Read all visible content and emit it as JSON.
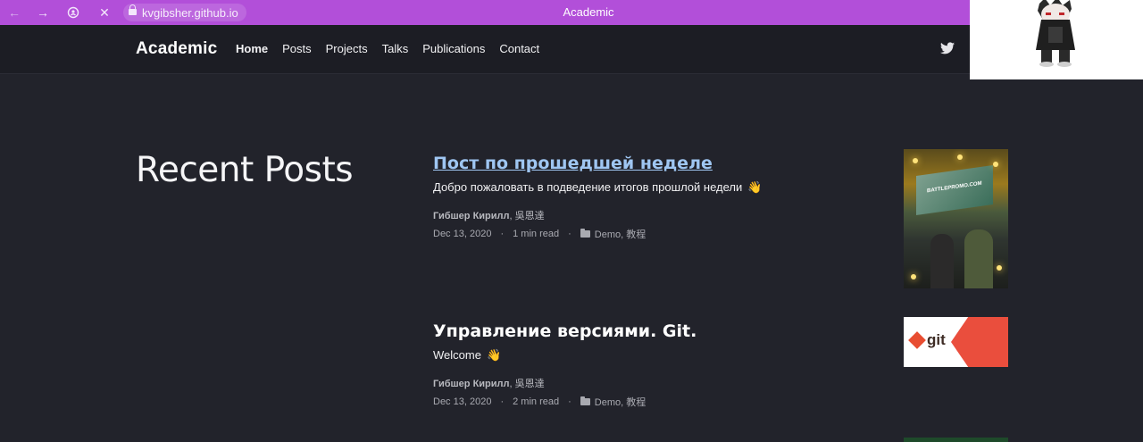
{
  "browser": {
    "url": "kvgibsher.github.io",
    "tab_title": "Academic"
  },
  "site": {
    "brand": "Academic",
    "nav": [
      {
        "label": "Home",
        "active": true
      },
      {
        "label": "Posts"
      },
      {
        "label": "Projects"
      },
      {
        "label": "Talks"
      },
      {
        "label": "Publications"
      },
      {
        "label": "Contact"
      }
    ]
  },
  "main": {
    "heading": "Recent Posts",
    "posts": [
      {
        "title": "Пост по прошедшей неделе",
        "summary": "Добро пожаловать в подведение итогов прошлой недели",
        "authors_bold": "Гибшер Кирилл",
        "authors_rest": ", 吳恩達",
        "date": "Dec 13, 2020",
        "read_time": "1 min read",
        "categories": "Demo, 教程",
        "thumb_text": "BATTLEPROMO.COM"
      },
      {
        "title": "Управление версиями. Git.",
        "summary": "Welcome",
        "authors_bold": "Гибшер Кирилл",
        "authors_rest": ", 吳恩達",
        "date": "Dec 13, 2020",
        "read_time": "2 min read",
        "categories": "Demo, 教程",
        "thumb_text": "git"
      }
    ],
    "separator": "·",
    "wave_emoji": "👋"
  },
  "colors": {
    "browser_bar": "#b24fd9",
    "background": "#22232b",
    "link": "#9fc6f2"
  }
}
